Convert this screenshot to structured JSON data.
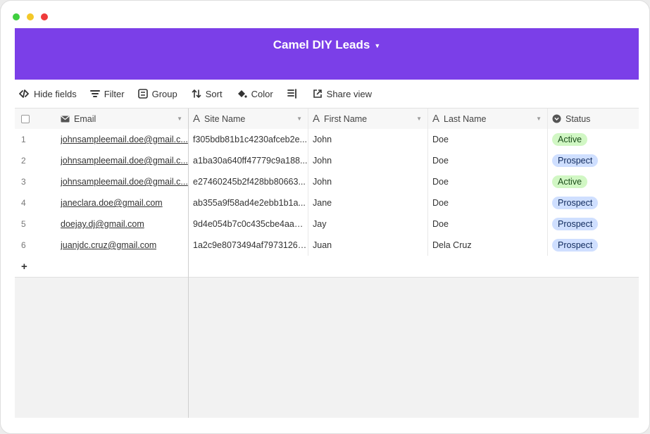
{
  "base": {
    "title": "Camel DIY Leads"
  },
  "toolbar": {
    "hide_fields": "Hide fields",
    "filter": "Filter",
    "group": "Group",
    "sort": "Sort",
    "color": "Color",
    "share_view": "Share view"
  },
  "columns": {
    "email": "Email",
    "site_name": "Site Name",
    "first_name": "First Name",
    "last_name": "Last Name",
    "status": "Status"
  },
  "rows": [
    {
      "num": "1",
      "email": "johnsampleemail.doe@gmail.c...",
      "site": "f305bdb81b1c4230afceb2e...",
      "first": "John",
      "last": "Doe",
      "status": "Active"
    },
    {
      "num": "2",
      "email": "johnsampleemail.doe@gmail.c...",
      "site": "a1ba30a640ff47779c9a188...",
      "first": "John",
      "last": "Doe",
      "status": "Prospect"
    },
    {
      "num": "3",
      "email": "johnsampleemail.doe@gmail.c...",
      "site": "e27460245b2f428bb80663...",
      "first": "John",
      "last": "Doe",
      "status": "Active"
    },
    {
      "num": "4",
      "email": "janeclara.doe@gmail.com",
      "site": "ab355a9f58ad4e2ebb1b1a...",
      "first": "Jane",
      "last": "Doe",
      "status": "Prospect"
    },
    {
      "num": "5",
      "email": "doejay.dj@gmail.com",
      "site": "9d4e054b7c0c435cbe4aabf...",
      "first": "Jay",
      "last": "Doe",
      "status": "Prospect"
    },
    {
      "num": "6",
      "email": "juanjdc.cruz@gmail.com",
      "site": "1a2c9e8073494af79731266...",
      "first": "Juan",
      "last": "Dela Cruz",
      "status": "Prospect"
    }
  ],
  "add_row_label": "+",
  "colors": {
    "header": "#7b3fe8",
    "status_active_bg": "#d1f7c4",
    "status_prospect_bg": "#cfdfff"
  }
}
